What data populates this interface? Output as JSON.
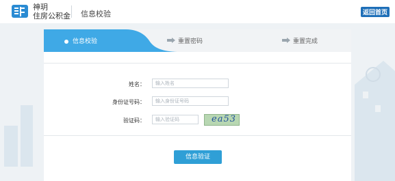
{
  "header": {
    "logo_text_line1": "神玥",
    "logo_text_line2": "住房公积金",
    "page_title": "信息校验",
    "home_button": "返回首页"
  },
  "steps": [
    {
      "label": "信息校验",
      "active": true
    },
    {
      "label": "重置密码",
      "active": false
    },
    {
      "label": "重置完成",
      "active": false
    }
  ],
  "form": {
    "name_label": "姓名：",
    "name_placeholder": "输入姓名",
    "id_label": "身份证号码：",
    "id_placeholder": "输入身份证号码",
    "code_label": "验证码：",
    "code_placeholder": "输入验证码",
    "captcha_text": "ea53"
  },
  "submit_label": "信息验证",
  "colors": {
    "accent": "#3fa9e6",
    "home_button": "#1e6fb8",
    "submit": "#2f9fd6"
  }
}
